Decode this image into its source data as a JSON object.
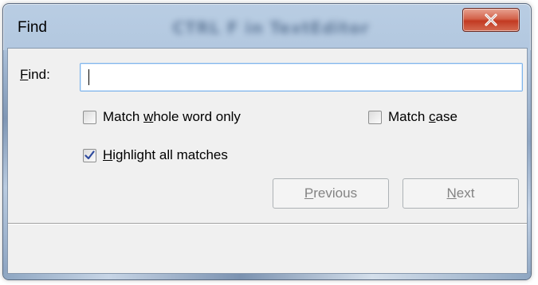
{
  "window": {
    "title": "Find",
    "blurred_caption": "CTRL F in TextEditor",
    "close_symbol": "X"
  },
  "find": {
    "label_prefix": "",
    "label_mnemonic": "F",
    "label_rest": "ind:",
    "value": "",
    "placeholder": ""
  },
  "options": {
    "whole_word": {
      "pre": "Match ",
      "mnemonic": "w",
      "post": "hole word only",
      "checked": false
    },
    "match_case": {
      "pre": "Match ",
      "mnemonic": "c",
      "post": "ase",
      "checked": false
    },
    "highlight": {
      "pre": "",
      "mnemonic": "H",
      "post": "ighlight all matches",
      "checked": true
    }
  },
  "buttons": {
    "previous": {
      "mnemonic": "P",
      "rest": "revious",
      "enabled": false
    },
    "next": {
      "mnemonic": "N",
      "rest": "ext",
      "enabled": false
    }
  },
  "colors": {
    "close_red": "#c23a22",
    "input_focus_border": "#7eb4ea",
    "check_mark": "#2e4a9e",
    "disabled_text": "#838383"
  },
  "icons": {
    "close": "close-icon",
    "check": "checkmark-icon"
  }
}
